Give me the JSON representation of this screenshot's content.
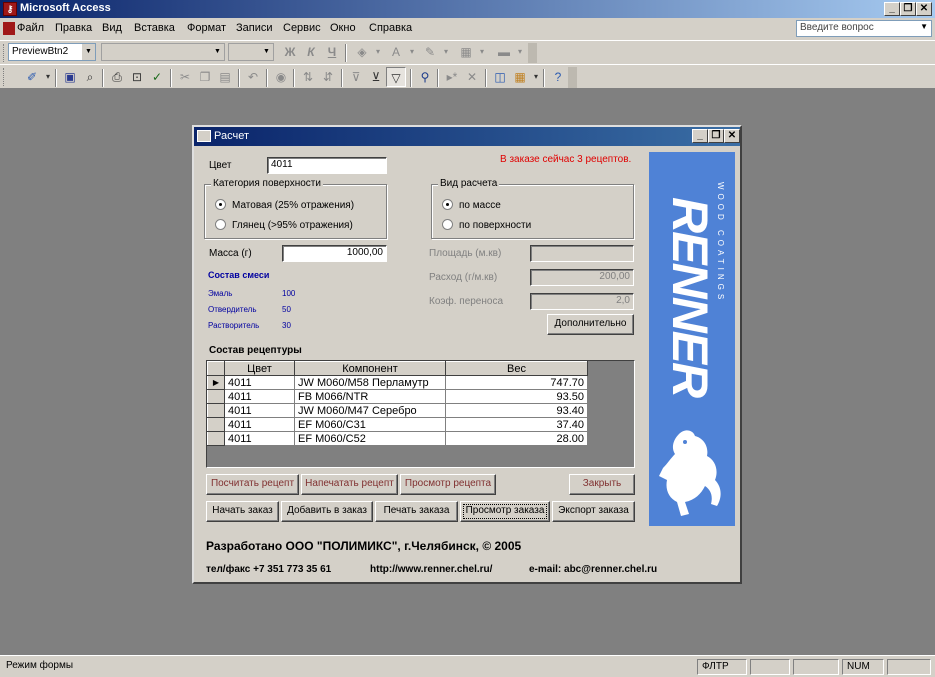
{
  "app": {
    "title": "Microsoft Access",
    "icon": "access-key-icon"
  },
  "window_buttons": {
    "minimize": "_",
    "restore": "❐",
    "close": "✕"
  },
  "menu": {
    "items": [
      "Файл",
      "Правка",
      "Вид",
      "Вставка",
      "Формат",
      "Записи",
      "Сервис",
      "Окно",
      "Справка"
    ],
    "ask_placeholder": "Введите вопрос"
  },
  "toolbar": {
    "object_combo": "PreviewBtn2",
    "font_combo": "",
    "size_combo": "",
    "bold": "Ж",
    "italic": "К",
    "underline": "Ч"
  },
  "status": {
    "left": "Режим формы",
    "filter": "ФЛТР",
    "num": "NUM"
  },
  "form": {
    "title": "Расчет",
    "color_label": "Цвет",
    "color_value": "4011",
    "order_message": "В заказе сейчас 3 рецептов.",
    "surface_group": {
      "title": "Категория поверхности",
      "options": [
        "Матовая (25% отражения)",
        "Глянец (>95% отражения)"
      ],
      "selected": 0
    },
    "calc_group": {
      "title": "Вид расчета",
      "options": [
        "по массе",
        "по поверхности"
      ],
      "selected": 0
    },
    "mass_label": "Масса (г)",
    "mass_value": "1000,00",
    "area_label": "Площадь (м.кв)",
    "area_value": "",
    "rate_label": "Расход (г/м.кв)",
    "rate_value": "200,00",
    "transfer_label": "Коэф. переноса",
    "transfer_value": "2,0",
    "more_button": "Дополнительно",
    "mix": {
      "title": "Состав смеси",
      "rows": [
        {
          "label": "Эмаль",
          "value": "100"
        },
        {
          "label": "Отвердитель",
          "value": "50"
        },
        {
          "label": "Растворитель",
          "value": "30"
        }
      ]
    },
    "recipe": {
      "title": "Состав рецептуры",
      "columns": [
        "Цвет",
        "Компонент",
        "Вес"
      ],
      "rows": [
        [
          "4011",
          "JW M060/M58 Перламутр",
          "747.70"
        ],
        [
          "4011",
          "FB M066/NTR",
          "93.50"
        ],
        [
          "4011",
          "JW M060/M47 Серебро",
          "93.40"
        ],
        [
          "4011",
          "EF M060/C31",
          "37.40"
        ],
        [
          "4011",
          "EF M060/C52",
          "28.00"
        ]
      ]
    },
    "buttons_row1": [
      "Посчитать рецепт",
      "Напечатать рецепт",
      "Просмотр рецепта"
    ],
    "close_button": "Закрыть",
    "buttons_row2": [
      "Начать заказ",
      "Добавить в заказ",
      "Печать заказа",
      "Просмотр заказа",
      "Экспорт заказа"
    ],
    "developer": "Разработано ООО \"ПОЛИМИКС\", г.Челябинск, © 2005",
    "phone": "тел/факс +7 351 773 35 61",
    "site": "http://www.renner.chel.ru/",
    "email": "e-mail:  abc@renner.chel.ru",
    "logo": {
      "brand": "RENNER",
      "tagline": "WOOD COATINGS",
      "icon": "horse-logo-icon"
    }
  },
  "colors": {
    "title_bar": "#0a246a",
    "logo_bg": "#4f82d6",
    "message": "#e00000",
    "mix_text": "#0000a0"
  }
}
